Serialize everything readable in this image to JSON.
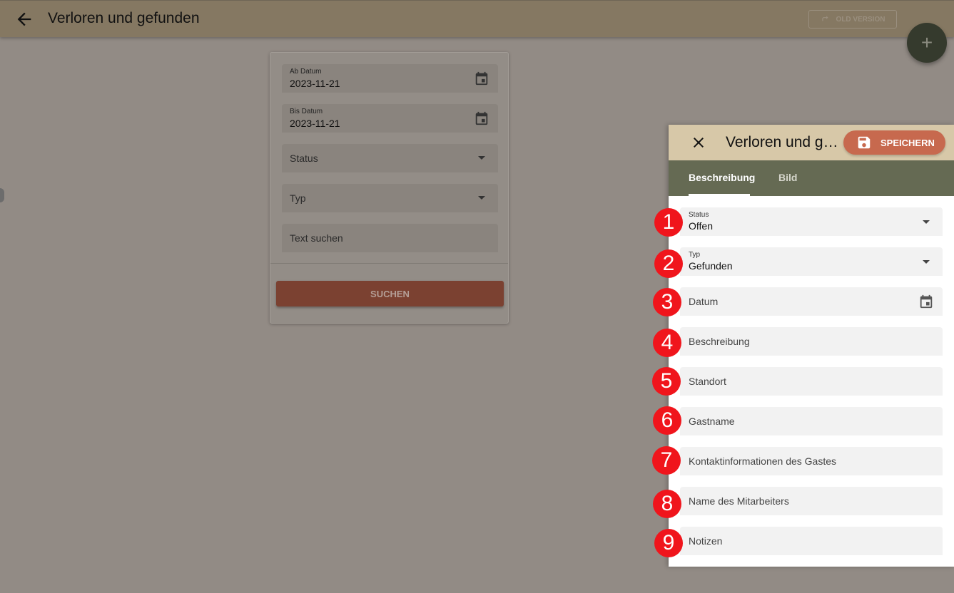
{
  "appbar": {
    "title": "Verloren und gefunden",
    "old_version_label": "OLD VERSION"
  },
  "fab": {
    "label": "+"
  },
  "search_card": {
    "from_date": {
      "label": "Ab Datum",
      "value": "2023-11-21"
    },
    "to_date": {
      "label": "Bis Datum",
      "value": "2023-11-21"
    },
    "status_placeholder": "Status",
    "type_placeholder": "Typ",
    "text_placeholder": "Text suchen",
    "search_label": "SUCHEN"
  },
  "panel": {
    "title": "Verloren und gefunden",
    "save_label": "SPEICHERN",
    "tabs": [
      {
        "label": "Beschreibung",
        "active": true
      },
      {
        "label": "Bild",
        "active": false
      }
    ],
    "fields": [
      {
        "badge": "1",
        "label": "Status",
        "value": "Offen"
      },
      {
        "badge": "2",
        "label": "Typ",
        "value": "Gefunden"
      },
      {
        "badge": "3",
        "placeholder": "Datum"
      },
      {
        "badge": "4",
        "placeholder": "Beschreibung"
      },
      {
        "badge": "5",
        "placeholder": "Standort"
      },
      {
        "badge": "6",
        "placeholder": "Gastname"
      },
      {
        "badge": "7",
        "placeholder": "Kontaktinformationen des Gastes"
      },
      {
        "badge": "8",
        "placeholder": "Name des Mitarbeiters"
      },
      {
        "badge": "9",
        "placeholder": "Notizen"
      }
    ]
  },
  "colors": {
    "overlay_bg": "#928b85",
    "appbar": "#857862",
    "panel_header": "#d7c8a8",
    "tabs_bg": "#656a53",
    "save_button": "#c7694e",
    "badge": "#f0151c"
  },
  "icons": {
    "back": "arrow-left-icon",
    "old_version": "redo-arrow-icon",
    "calendar": "calendar-icon",
    "close": "close-icon",
    "save": "floppy-disk-icon",
    "dropdown": "caret-down-icon"
  }
}
